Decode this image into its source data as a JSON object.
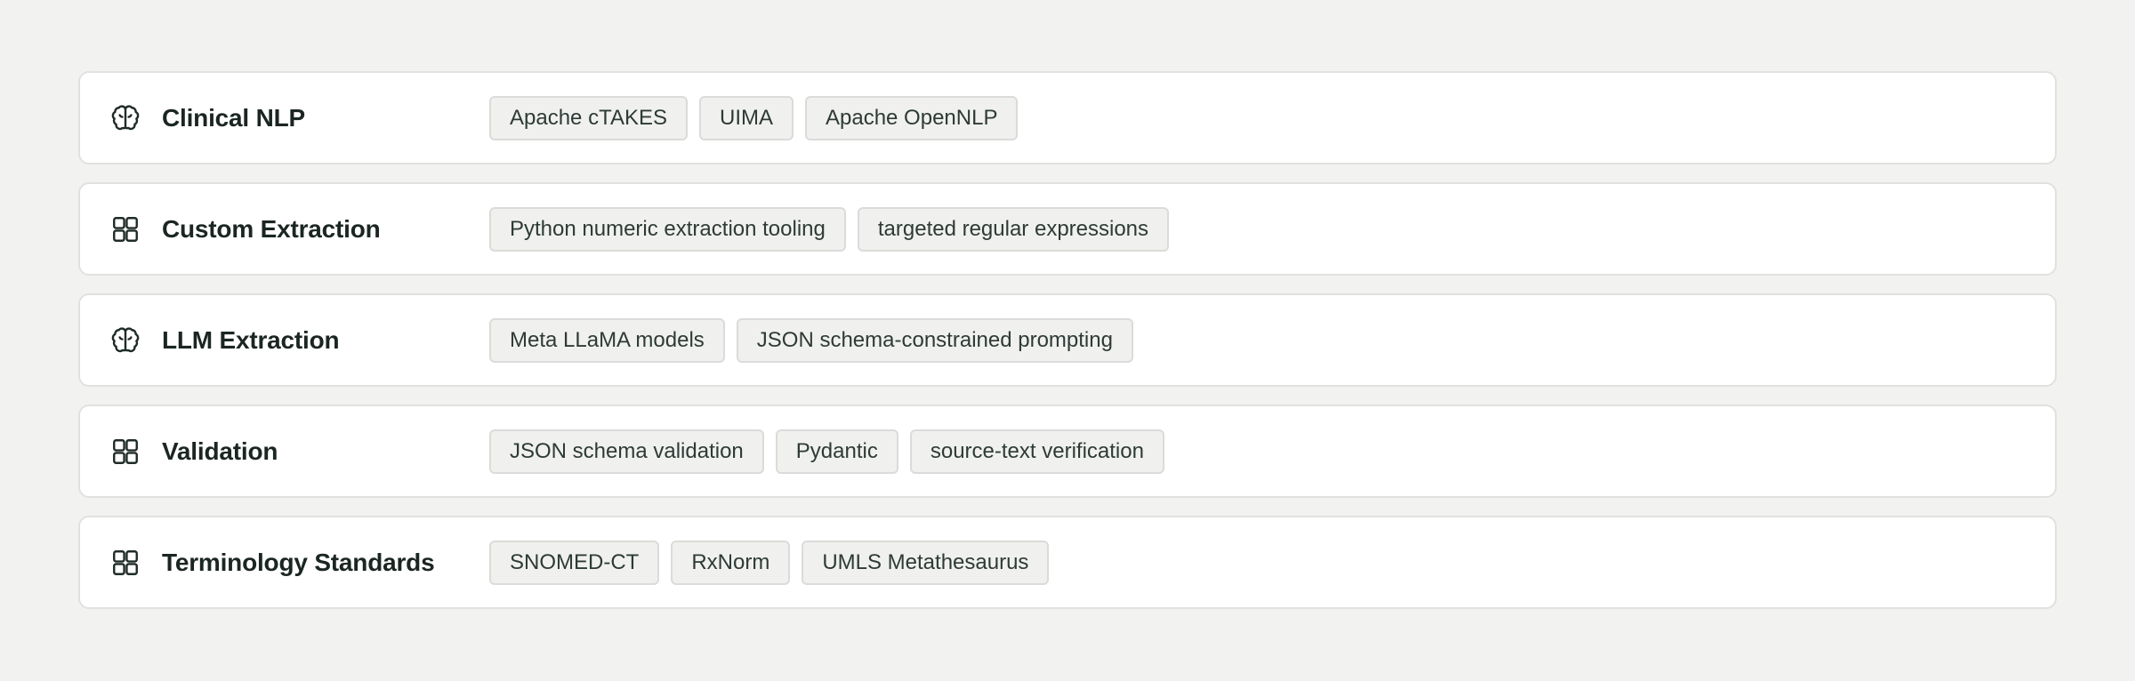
{
  "categories": [
    {
      "icon": "brain-icon",
      "title": "Clinical NLP",
      "tags": [
        "Apache cTAKES",
        "UIMA",
        "Apache OpenNLP"
      ]
    },
    {
      "icon": "grid-icon",
      "title": "Custom Extraction",
      "tags": [
        "Python numeric extraction tooling",
        "targeted regular expressions"
      ]
    },
    {
      "icon": "brain-icon",
      "title": "LLM Extraction",
      "tags": [
        "Meta LLaMA models",
        "JSON schema-constrained prompting"
      ]
    },
    {
      "icon": "grid-icon",
      "title": "Validation",
      "tags": [
        "JSON schema validation",
        "Pydantic",
        "source-text verification"
      ]
    },
    {
      "icon": "grid-icon",
      "title": "Terminology Standards",
      "tags": [
        "SNOMED-CT",
        "RxNorm",
        "UMLS Metathesaurus"
      ]
    }
  ],
  "colors": {
    "background": "#f2f3f1",
    "card": "#ffffff",
    "card_border": "#dfe2df",
    "tag_background": "#f0f1ef",
    "tag_border": "#dadcd9",
    "text": "#1b2622"
  }
}
